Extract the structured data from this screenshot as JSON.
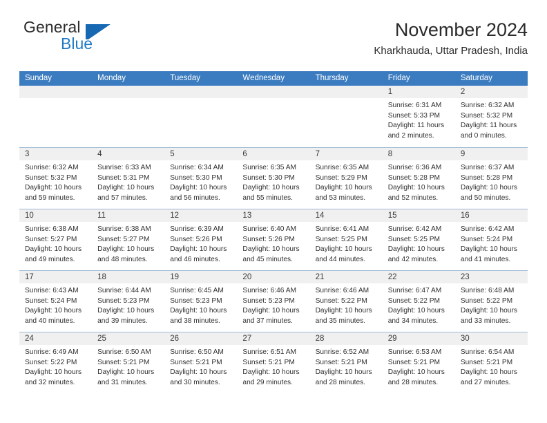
{
  "brand": {
    "name_top": "General",
    "name_bottom": "Blue",
    "mark": "triangle-logo"
  },
  "header": {
    "title": "November 2024",
    "subtitle": "Kharkhauda, Uttar Pradesh, India"
  },
  "colors": {
    "header_blue": "#3b7cc0",
    "brand_blue": "#1f7ac4",
    "date_band": "#f0f0f0",
    "row_border": "#9fb9d6"
  },
  "weekdays": [
    "Sunday",
    "Monday",
    "Tuesday",
    "Wednesday",
    "Thursday",
    "Friday",
    "Saturday"
  ],
  "weeks": [
    [
      {
        "day": "",
        "sunrise": "",
        "sunset": "",
        "daylight1": "",
        "daylight2": "",
        "empty": true
      },
      {
        "day": "",
        "sunrise": "",
        "sunset": "",
        "daylight1": "",
        "daylight2": "",
        "empty": true
      },
      {
        "day": "",
        "sunrise": "",
        "sunset": "",
        "daylight1": "",
        "daylight2": "",
        "empty": true
      },
      {
        "day": "",
        "sunrise": "",
        "sunset": "",
        "daylight1": "",
        "daylight2": "",
        "empty": true
      },
      {
        "day": "",
        "sunrise": "",
        "sunset": "",
        "daylight1": "",
        "daylight2": "",
        "empty": true
      },
      {
        "day": "1",
        "sunrise": "Sunrise: 6:31 AM",
        "sunset": "Sunset: 5:33 PM",
        "daylight1": "Daylight: 11 hours",
        "daylight2": "and 2 minutes.",
        "empty": false
      },
      {
        "day": "2",
        "sunrise": "Sunrise: 6:32 AM",
        "sunset": "Sunset: 5:32 PM",
        "daylight1": "Daylight: 11 hours",
        "daylight2": "and 0 minutes.",
        "empty": false
      }
    ],
    [
      {
        "day": "3",
        "sunrise": "Sunrise: 6:32 AM",
        "sunset": "Sunset: 5:32 PM",
        "daylight1": "Daylight: 10 hours",
        "daylight2": "and 59 minutes.",
        "empty": false
      },
      {
        "day": "4",
        "sunrise": "Sunrise: 6:33 AM",
        "sunset": "Sunset: 5:31 PM",
        "daylight1": "Daylight: 10 hours",
        "daylight2": "and 57 minutes.",
        "empty": false
      },
      {
        "day": "5",
        "sunrise": "Sunrise: 6:34 AM",
        "sunset": "Sunset: 5:30 PM",
        "daylight1": "Daylight: 10 hours",
        "daylight2": "and 56 minutes.",
        "empty": false
      },
      {
        "day": "6",
        "sunrise": "Sunrise: 6:35 AM",
        "sunset": "Sunset: 5:30 PM",
        "daylight1": "Daylight: 10 hours",
        "daylight2": "and 55 minutes.",
        "empty": false
      },
      {
        "day": "7",
        "sunrise": "Sunrise: 6:35 AM",
        "sunset": "Sunset: 5:29 PM",
        "daylight1": "Daylight: 10 hours",
        "daylight2": "and 53 minutes.",
        "empty": false
      },
      {
        "day": "8",
        "sunrise": "Sunrise: 6:36 AM",
        "sunset": "Sunset: 5:28 PM",
        "daylight1": "Daylight: 10 hours",
        "daylight2": "and 52 minutes.",
        "empty": false
      },
      {
        "day": "9",
        "sunrise": "Sunrise: 6:37 AM",
        "sunset": "Sunset: 5:28 PM",
        "daylight1": "Daylight: 10 hours",
        "daylight2": "and 50 minutes.",
        "empty": false
      }
    ],
    [
      {
        "day": "10",
        "sunrise": "Sunrise: 6:38 AM",
        "sunset": "Sunset: 5:27 PM",
        "daylight1": "Daylight: 10 hours",
        "daylight2": "and 49 minutes.",
        "empty": false
      },
      {
        "day": "11",
        "sunrise": "Sunrise: 6:38 AM",
        "sunset": "Sunset: 5:27 PM",
        "daylight1": "Daylight: 10 hours",
        "daylight2": "and 48 minutes.",
        "empty": false
      },
      {
        "day": "12",
        "sunrise": "Sunrise: 6:39 AM",
        "sunset": "Sunset: 5:26 PM",
        "daylight1": "Daylight: 10 hours",
        "daylight2": "and 46 minutes.",
        "empty": false
      },
      {
        "day": "13",
        "sunrise": "Sunrise: 6:40 AM",
        "sunset": "Sunset: 5:26 PM",
        "daylight1": "Daylight: 10 hours",
        "daylight2": "and 45 minutes.",
        "empty": false
      },
      {
        "day": "14",
        "sunrise": "Sunrise: 6:41 AM",
        "sunset": "Sunset: 5:25 PM",
        "daylight1": "Daylight: 10 hours",
        "daylight2": "and 44 minutes.",
        "empty": false
      },
      {
        "day": "15",
        "sunrise": "Sunrise: 6:42 AM",
        "sunset": "Sunset: 5:25 PM",
        "daylight1": "Daylight: 10 hours",
        "daylight2": "and 42 minutes.",
        "empty": false
      },
      {
        "day": "16",
        "sunrise": "Sunrise: 6:42 AM",
        "sunset": "Sunset: 5:24 PM",
        "daylight1": "Daylight: 10 hours",
        "daylight2": "and 41 minutes.",
        "empty": false
      }
    ],
    [
      {
        "day": "17",
        "sunrise": "Sunrise: 6:43 AM",
        "sunset": "Sunset: 5:24 PM",
        "daylight1": "Daylight: 10 hours",
        "daylight2": "and 40 minutes.",
        "empty": false
      },
      {
        "day": "18",
        "sunrise": "Sunrise: 6:44 AM",
        "sunset": "Sunset: 5:23 PM",
        "daylight1": "Daylight: 10 hours",
        "daylight2": "and 39 minutes.",
        "empty": false
      },
      {
        "day": "19",
        "sunrise": "Sunrise: 6:45 AM",
        "sunset": "Sunset: 5:23 PM",
        "daylight1": "Daylight: 10 hours",
        "daylight2": "and 38 minutes.",
        "empty": false
      },
      {
        "day": "20",
        "sunrise": "Sunrise: 6:46 AM",
        "sunset": "Sunset: 5:23 PM",
        "daylight1": "Daylight: 10 hours",
        "daylight2": "and 37 minutes.",
        "empty": false
      },
      {
        "day": "21",
        "sunrise": "Sunrise: 6:46 AM",
        "sunset": "Sunset: 5:22 PM",
        "daylight1": "Daylight: 10 hours",
        "daylight2": "and 35 minutes.",
        "empty": false
      },
      {
        "day": "22",
        "sunrise": "Sunrise: 6:47 AM",
        "sunset": "Sunset: 5:22 PM",
        "daylight1": "Daylight: 10 hours",
        "daylight2": "and 34 minutes.",
        "empty": false
      },
      {
        "day": "23",
        "sunrise": "Sunrise: 6:48 AM",
        "sunset": "Sunset: 5:22 PM",
        "daylight1": "Daylight: 10 hours",
        "daylight2": "and 33 minutes.",
        "empty": false
      }
    ],
    [
      {
        "day": "24",
        "sunrise": "Sunrise: 6:49 AM",
        "sunset": "Sunset: 5:22 PM",
        "daylight1": "Daylight: 10 hours",
        "daylight2": "and 32 minutes.",
        "empty": false
      },
      {
        "day": "25",
        "sunrise": "Sunrise: 6:50 AM",
        "sunset": "Sunset: 5:21 PM",
        "daylight1": "Daylight: 10 hours",
        "daylight2": "and 31 minutes.",
        "empty": false
      },
      {
        "day": "26",
        "sunrise": "Sunrise: 6:50 AM",
        "sunset": "Sunset: 5:21 PM",
        "daylight1": "Daylight: 10 hours",
        "daylight2": "and 30 minutes.",
        "empty": false
      },
      {
        "day": "27",
        "sunrise": "Sunrise: 6:51 AM",
        "sunset": "Sunset: 5:21 PM",
        "daylight1": "Daylight: 10 hours",
        "daylight2": "and 29 minutes.",
        "empty": false
      },
      {
        "day": "28",
        "sunrise": "Sunrise: 6:52 AM",
        "sunset": "Sunset: 5:21 PM",
        "daylight1": "Daylight: 10 hours",
        "daylight2": "and 28 minutes.",
        "empty": false
      },
      {
        "day": "29",
        "sunrise": "Sunrise: 6:53 AM",
        "sunset": "Sunset: 5:21 PM",
        "daylight1": "Daylight: 10 hours",
        "daylight2": "and 28 minutes.",
        "empty": false
      },
      {
        "day": "30",
        "sunrise": "Sunrise: 6:54 AM",
        "sunset": "Sunset: 5:21 PM",
        "daylight1": "Daylight: 10 hours",
        "daylight2": "and 27 minutes.",
        "empty": false
      }
    ]
  ]
}
